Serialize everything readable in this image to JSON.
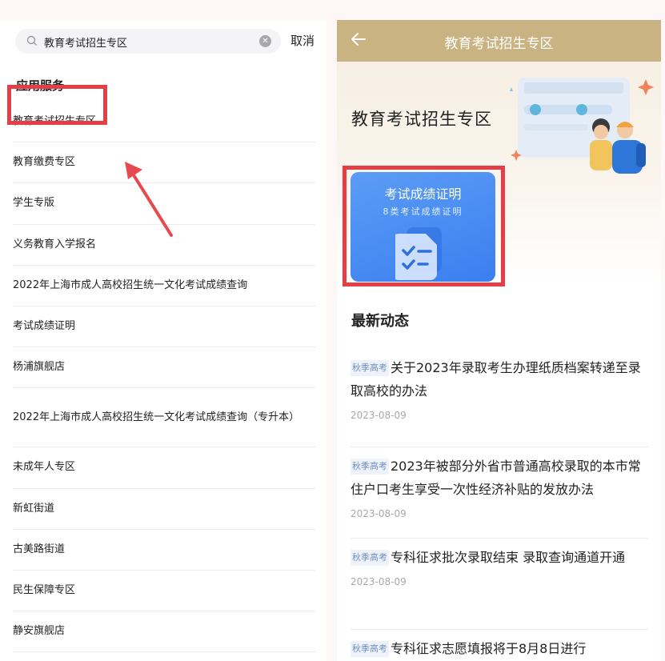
{
  "left": {
    "search": {
      "query": "教育考试招生专区",
      "cancel_label": "取消"
    },
    "section_title": "应用服务",
    "items": [
      "教育考试招生专区",
      "教育缴费专区",
      "学生专版",
      "义务教育入学报名",
      "2022年上海市成人高校招生统一文化考试成绩查询",
      "考试成绩证明",
      "杨浦旗舰店",
      "2022年上海市成人高校招生统一文化考试成绩查询（专升本）",
      "未成年人专区",
      "新虹街道",
      "古美路街道",
      "民生保障专区",
      "静安旗舰店"
    ]
  },
  "right": {
    "topbar_title": "教育考试招生专区",
    "hero_title": "教育考试招生专区",
    "card": {
      "title": "考试成绩证明",
      "subtitle": "8类考试成绩证明"
    },
    "news_section_title": "最新动态",
    "news": [
      {
        "tag": "秋季高考",
        "title": "关于2023年录取考生办理纸质档案转递至录取高校的办法",
        "date": "2023-08-09"
      },
      {
        "tag": "秋季高考",
        "title": "2023年被部分外省市普通高校录取的本市常住户口考生享受一次性经济补贴的发放办法",
        "date": "2023-08-09"
      },
      {
        "tag": "秋季高考",
        "title": "专科征求批次录取结束 录取查询通道开通",
        "date": "2023-08-09"
      },
      {
        "tag": "秋季高考",
        "title": "专科征求志愿填报将于8月8日进行",
        "date": ""
      }
    ]
  },
  "colors": {
    "highlight": "#e43f47",
    "topbar": "#c9b382",
    "card": "#3a7ff0"
  },
  "icons": [
    "search-icon",
    "clear-icon",
    "back-arrow-icon",
    "document-check-icon",
    "red-arrow-annotation"
  ]
}
